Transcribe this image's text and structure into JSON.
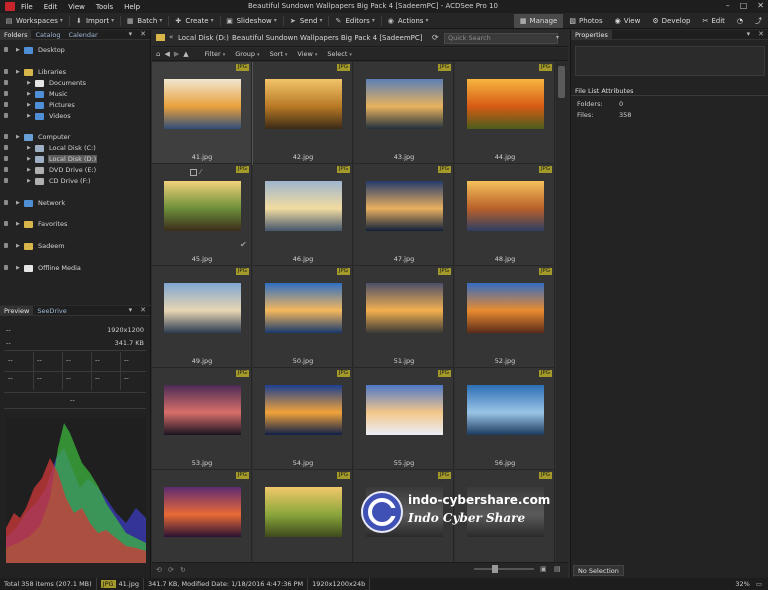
{
  "menu": {
    "items": [
      "File",
      "Edit",
      "View",
      "Tools",
      "Help"
    ],
    "title": "Beautiful Sundown Wallpapers Big Pack 4 [SadeemPC] - ACDSee Pro 10"
  },
  "toolbar": {
    "workspaces": "Workspaces",
    "import": "Import",
    "batch": "Batch",
    "create": "Create",
    "slideshow": "Slideshow",
    "send": "Send",
    "editors": "Editors",
    "actions": "Actions"
  },
  "modes": {
    "manage": "Manage",
    "photos": "Photos",
    "view": "View",
    "develop": "Develop",
    "edit": "Edit"
  },
  "left_tabs": [
    "Folders",
    "Catalog",
    "Calendar"
  ],
  "tree": [
    {
      "label": "Desktop",
      "indent": 0,
      "color": "#4f8fd6"
    },
    {
      "label": "Libraries",
      "indent": 0,
      "color": "#d9b64a"
    },
    {
      "label": "Documents",
      "indent": 1,
      "color": "#e5e5e5"
    },
    {
      "label": "Music",
      "indent": 1,
      "color": "#4f8fd6"
    },
    {
      "label": "Pictures",
      "indent": 1,
      "color": "#4f8fd6"
    },
    {
      "label": "Videos",
      "indent": 1,
      "color": "#4f8fd6"
    },
    {
      "label": "Computer",
      "indent": 0,
      "color": "#6aa0d8"
    },
    {
      "label": "Local Disk (C:)",
      "indent": 1,
      "color": "#9fb0c4"
    },
    {
      "label": "Local Disk (D:)",
      "indent": 1,
      "color": "#9fb0c4",
      "selected": true
    },
    {
      "label": "DVD Drive (E:)",
      "indent": 1,
      "color": "#b0b0b0"
    },
    {
      "label": "CD Drive (F:)",
      "indent": 1,
      "color": "#b0b0b0"
    },
    {
      "label": "Network",
      "indent": 0,
      "color": "#4f8fd6"
    },
    {
      "label": "Favorites",
      "indent": 0,
      "color": "#d9b64a"
    },
    {
      "label": "Sadeem",
      "indent": 0,
      "color": "#d9b64a"
    },
    {
      "label": "Offline Media",
      "indent": 0,
      "color": "#e5e5e5"
    }
  ],
  "preview": {
    "tabs": [
      "Preview",
      "SeeDrive"
    ],
    "resolution": "1920x1200",
    "size": "341.7 KB",
    "placeholder": "--"
  },
  "path": {
    "back": "«",
    "disk": "Local Disk (D:)",
    "folder": "Beautiful Sundown Wallpapers Big Pack 4 [SadeemPC]",
    "search_placeholder": "Quick Search"
  },
  "filters": [
    "Filter",
    "Group",
    "Sort",
    "View",
    "Select"
  ],
  "files": [
    {
      "name": "41.jpg",
      "badge": "JPG",
      "c1": "#f0e6d0",
      "c2": "#e9a13c",
      "c3": "#2f4d7a",
      "selected": true
    },
    {
      "name": "42.jpg",
      "badge": "JPG",
      "c1": "#f2c46a",
      "c2": "#b87926",
      "c3": "#3b2a16"
    },
    {
      "name": "43.jpg",
      "badge": "JPG",
      "c1": "#5b7fb5",
      "c2": "#e8b25d",
      "c3": "#20303d"
    },
    {
      "name": "44.jpg",
      "badge": "JPG",
      "c1": "#f7b540",
      "c2": "#d65b15",
      "c3": "#4a5d1c"
    },
    {
      "name": "45.jpg",
      "badge": "JPG",
      "c1": "#f2d27b",
      "c2": "#6d8f3a",
      "c3": "#3a2c1b"
    },
    {
      "name": "46.jpg",
      "badge": "JPG",
      "c1": "#9fb5cf",
      "c2": "#f2dca0",
      "c3": "#44556c"
    },
    {
      "name": "47.jpg",
      "badge": "JPG",
      "c1": "#243b6b",
      "c2": "#e9b060",
      "c3": "#11203a"
    },
    {
      "name": "48.jpg",
      "badge": "JPG",
      "c1": "#f6c15b",
      "c2": "#b9602a",
      "c3": "#2d3e63"
    },
    {
      "name": "49.jpg",
      "badge": "JPG",
      "c1": "#7fa6d2",
      "c2": "#e8d6b3",
      "c3": "#2d3b50"
    },
    {
      "name": "50.jpg",
      "badge": "JPG",
      "c1": "#2f6fc2",
      "c2": "#f5b85d",
      "c3": "#173a6d"
    },
    {
      "name": "51.jpg",
      "badge": "JPG",
      "c1": "#4c4f6a",
      "c2": "#f3b04f",
      "c3": "#3a3a36"
    },
    {
      "name": "52.jpg",
      "badge": "JPG",
      "c1": "#356cc2",
      "c2": "#e98b2f",
      "c3": "#5a2b19"
    },
    {
      "name": "53.jpg",
      "badge": "JPG",
      "c1": "#4a2b55",
      "c2": "#d86f6a",
      "c3": "#1a1320"
    },
    {
      "name": "54.jpg",
      "badge": "JPG",
      "c1": "#1c3f8f",
      "c2": "#f1a33a",
      "c3": "#0e1f48"
    },
    {
      "name": "55.jpg",
      "badge": "JPG",
      "c1": "#4c78c6",
      "c2": "#f4c78b",
      "c3": "#e9eef7"
    },
    {
      "name": "56.jpg",
      "badge": "JPG",
      "c1": "#2b6fb5",
      "c2": "#9ac4e6",
      "c3": "#1b3b5d"
    },
    {
      "name": "",
      "badge": "JPG",
      "c1": "#5c2a72",
      "c2": "#e96a36",
      "c3": "#2a1234"
    },
    {
      "name": "",
      "badge": "JPG",
      "c1": "#f2c86a",
      "c2": "#8aa63b",
      "c3": "#3d4a1c"
    },
    {
      "name": "",
      "badge": "JPG",
      "c1": "#3a3a3a",
      "c2": "#5a5a5a",
      "c3": "#2a2a2a"
    },
    {
      "name": "",
      "badge": "JPG",
      "c1": "#3a3a3a",
      "c2": "#5a5a5a",
      "c3": "#2a2a2a"
    }
  ],
  "watermark": {
    "url": "indo-cybershare.com",
    "name": "Indo Cyber Share"
  },
  "properties": {
    "title": "Properties",
    "section": "File List Attributes",
    "folders_label": "Folders:",
    "folders_value": "0",
    "files_label": "Files:",
    "files_value": "358",
    "tab": "No Selection"
  },
  "status": {
    "total": "Total 358 items  (207.1 MB)",
    "badge": "JPG",
    "file": "41.jpg",
    "info": "341.7 KB, Modified Date: 1/18/2016 4:47:36 PM",
    "dims": "1920x1200x24b",
    "zoom": "32%"
  }
}
